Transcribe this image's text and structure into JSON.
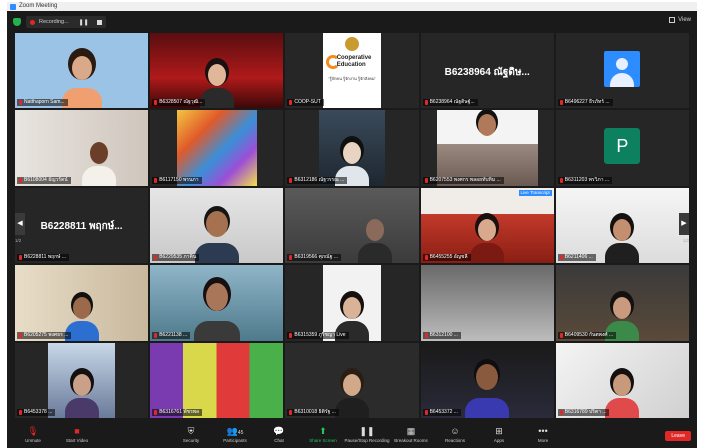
{
  "window": {
    "title": "Zoom Meeting"
  },
  "recording": {
    "label": "Recording..."
  },
  "view": {
    "label": "View"
  },
  "pagination": {
    "left": "1/2",
    "right": "1/2"
  },
  "tiles": [
    {
      "name": "Natthaporn Sam...",
      "active": true
    },
    {
      "name": "B6328507 ณัฐวุฒิ..."
    },
    {
      "name": "COOP-SUT",
      "logo": {
        "title_line1": "Cooperative",
        "title_line2": "Education",
        "motto": "\"รู้จักคน รู้จักงาน รู้จักสังคม\""
      }
    },
    {
      "name": "B6238964 ณัฐดิษฐ์...",
      "big_name": "B6238964 ณัฐดิษ..."
    },
    {
      "name": "B6496227 ธีรภัทร์ ...",
      "avatar": true
    },
    {
      "name": "B6108004 ธัญวรัตน์"
    },
    {
      "name": "B6117150 พรนภา"
    },
    {
      "name": "B6312186 ณัฐวรรณ ..."
    },
    {
      "name": "B6207553 พงศกร พลอยทับทิม ..."
    },
    {
      "name": "B6311203 พรวิภา ...",
      "initial": "P"
    },
    {
      "name": "B6228811 พฤกษ์ ...",
      "big_name": "B6228811 พฤกษ์..."
    },
    {
      "name": "B6229535 ภาคิน"
    },
    {
      "name": "B6319566 ศุภณัฐ ..."
    },
    {
      "name": "B6455255 อัญชลี",
      "tag": "Live Transcript"
    },
    {
      "name": "B6211406 ..."
    },
    {
      "name": "B6205275 พงศธร ..."
    },
    {
      "name": "B6221138 ..."
    },
    {
      "name": "B6315359 ภูริชญา Live"
    },
    {
      "name": "B6312100 ..."
    },
    {
      "name": "B6409530 กันตพงศ์ ..."
    },
    {
      "name": "B6453378 ..."
    },
    {
      "name": "B6316761 พัชรพล"
    },
    {
      "name": "B6310018 ธิติรัฐ ..."
    },
    {
      "name": "B6453372 ..."
    },
    {
      "name": "B6316789 ปริตา ..."
    }
  ],
  "toolbar": {
    "unmute": "Unmute",
    "start_video": "Start Video",
    "security": "Security",
    "participants": "Participants",
    "participants_count": "45",
    "chat": "Chat",
    "share_screen": "Share Screen",
    "record": "Pause/Stop Recording",
    "breakout": "Breakout Rooms",
    "reactions": "Reactions",
    "apps": "Apps",
    "more": "More",
    "end": "Leave"
  },
  "colors": {
    "accent_green": "#22c55e",
    "active_speaker": "#d6e83a",
    "end_red": "#e02828",
    "avatar_blue": "#2d8cff",
    "initial_green": "#0d8060"
  }
}
